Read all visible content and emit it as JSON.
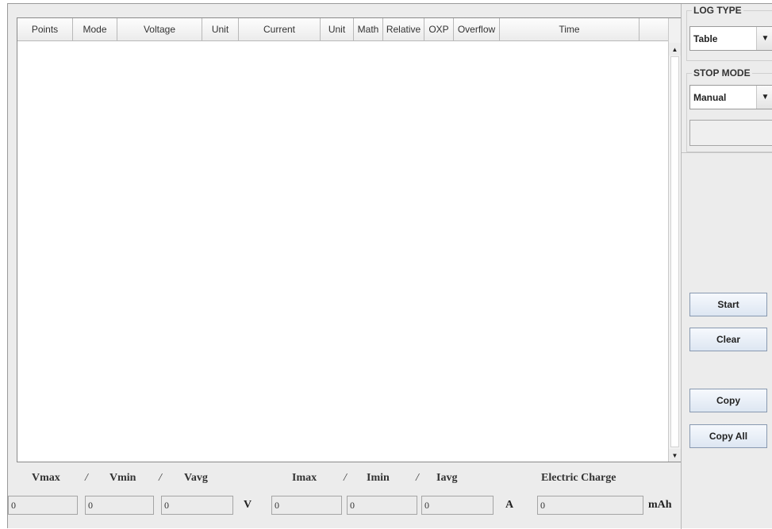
{
  "table": {
    "columns": [
      "Points",
      "Mode",
      "Voltage",
      "Unit",
      "Current",
      "Unit",
      "Math",
      "Relative",
      "OXP",
      "Overflow",
      "Time"
    ],
    "rows": []
  },
  "stats": {
    "vmax_label": "Vmax",
    "vmin_label": "Vmin",
    "vavg_label": "Vavg",
    "imax_label": "Imax",
    "imin_label": "Imin",
    "iavg_label": "Iavg",
    "charge_label": "Electric Charge",
    "slash": "/",
    "vmax": "0",
    "vmin": "0",
    "vavg": "0",
    "imax": "0",
    "imin": "0",
    "iavg": "0",
    "charge": "0",
    "voltage_unit": "V",
    "current_unit": "A",
    "charge_unit": "mAh"
  },
  "right_panel": {
    "log_type_title": "LOG TYPE",
    "log_type_value": "Table",
    "stop_mode_title": "STOP MODE",
    "stop_mode_value": "Manual",
    "stop_mode_input": "",
    "buttons": {
      "start": "Start",
      "clear": "Clear",
      "copy": "Copy",
      "copy_all": "Copy All"
    }
  },
  "icons": {
    "scroll_up": "triangle-up-icon",
    "scroll_down": "triangle-down-icon",
    "dropdown": "triangle-down-icon"
  }
}
